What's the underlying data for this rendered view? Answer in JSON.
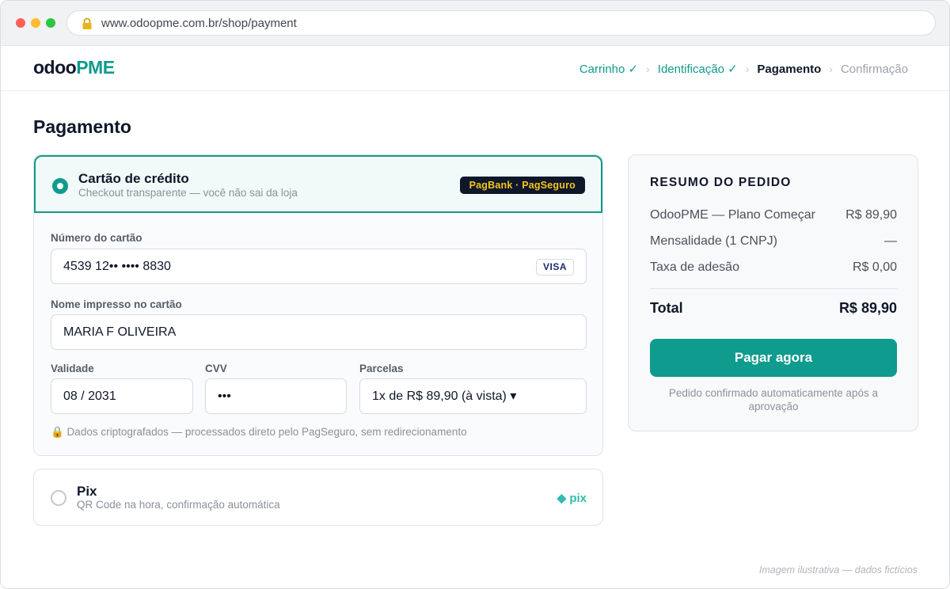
{
  "browser": {
    "url": "www.odoopme.com.br/shop/payment"
  },
  "header": {
    "logo_part1": "odoo",
    "logo_part2": "PME",
    "steps": [
      {
        "label": "Carrinho ✓",
        "state": "done"
      },
      {
        "label": "Identificação ✓",
        "state": "done"
      },
      {
        "label": "Pagamento",
        "state": "current"
      },
      {
        "label": "Confirmação",
        "state": "upcoming"
      }
    ],
    "step_separator": "›"
  },
  "page": {
    "title": "Pagamento"
  },
  "card_option": {
    "title": "Cartão de crédito",
    "subtitle": "Checkout transparente — você não sai da loja",
    "badge": "PagBank · PagSeguro",
    "selected": true,
    "card_number_label": "Número do cartão",
    "card_number_value": "4539 12•• •••• 8830",
    "card_brand": "VISA",
    "name_label": "Nome impresso no cartão",
    "name_value": "MARIA F OLIVEIRA",
    "expiry_label": "Validade",
    "expiry_value": "08 / 2031",
    "cvv_label": "CVV",
    "cvv_value": "•••",
    "installments_label": "Parcelas",
    "installments_value": "1x de R$ 89,90 (à vista) ▾",
    "security_note": "🔒 Dados criptografados — processados direto pelo PagSeguro, sem redirecionamento"
  },
  "pix_option": {
    "title": "Pix",
    "subtitle": "QR Code na hora, confirmação automática",
    "logo_text": "◆ pix",
    "selected": false
  },
  "summary": {
    "title": "RESUMO DO PEDIDO",
    "rows": [
      {
        "label": "OdooPME — Plano Começar",
        "value": "R$ 89,90"
      },
      {
        "label": "Mensalidade (1 CNPJ)",
        "value": "—"
      },
      {
        "label": "Taxa de adesão",
        "value": "R$ 0,00"
      }
    ],
    "total_label": "Total",
    "total_value": "R$ 89,90",
    "pay_button": "Pagar agora",
    "note": "Pedido confirmado automaticamente após a aprovação"
  },
  "footer_note": "Imagem ilustrativa — dados fictícios",
  "colors": {
    "accent": "#0f9b8e",
    "dark": "#0f172a",
    "badge_text": "#f5c518",
    "pix": "#32bcad"
  }
}
